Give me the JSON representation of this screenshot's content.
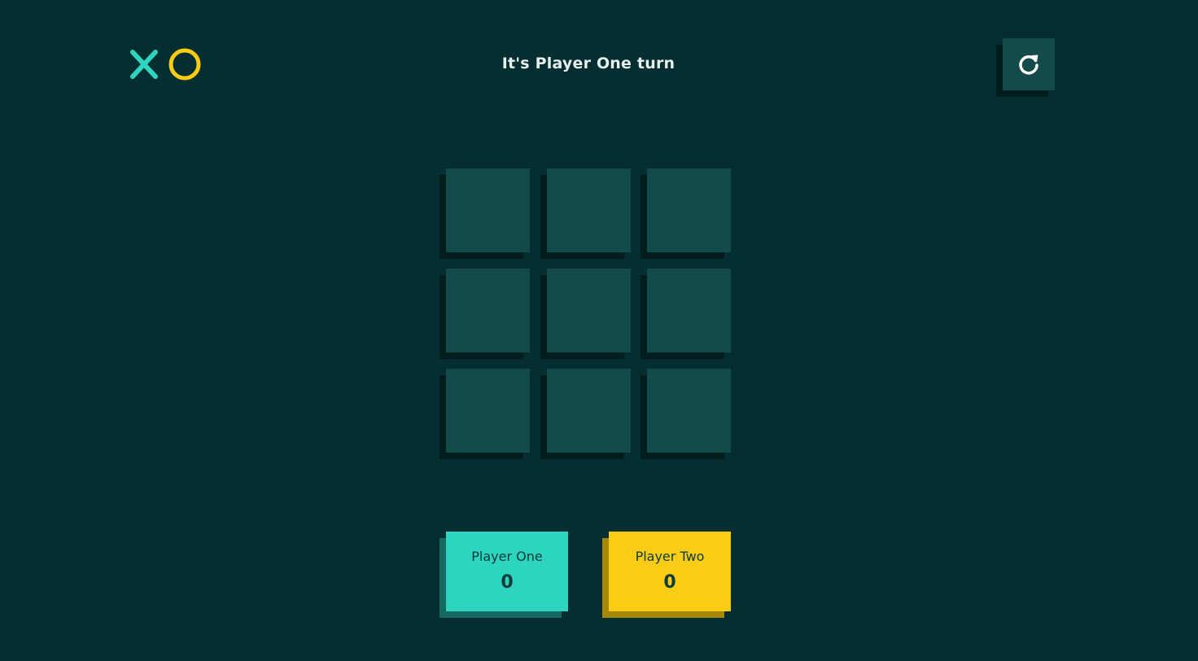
{
  "header": {
    "logo_icons": [
      "x-mark-icon",
      "o-mark-icon"
    ],
    "turn_text": "It's Player One turn",
    "restart_icon": "restart-icon"
  },
  "board": {
    "cells": [
      "",
      "",
      "",
      "",
      "",
      "",
      "",
      "",
      ""
    ]
  },
  "scores": {
    "player_one": {
      "label": "Player One",
      "value": "0"
    },
    "player_two": {
      "label": "Player Two",
      "value": "0"
    }
  },
  "colors": {
    "background": "#042e2f",
    "cell": "#134a4a",
    "x_color": "#2dd4bf",
    "o_color": "#facc15"
  }
}
